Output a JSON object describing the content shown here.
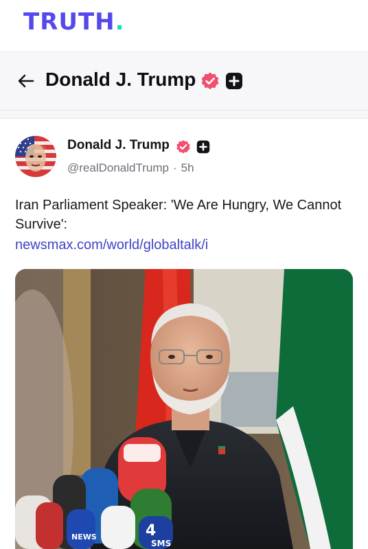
{
  "brand": {
    "logo_text": "TRUTH",
    "logo_dot": ".",
    "primary_color": "#5448ee",
    "dot_color": "#17e0b8"
  },
  "header": {
    "title": "Donald J. Trump",
    "back_icon": "arrow-left-icon",
    "verified_icon": "verified-badge-icon",
    "plus_icon": "truth-plus-icon",
    "verified_color": "#f0506e"
  },
  "post": {
    "author": {
      "name": "Donald J. Trump",
      "handle": "@realDonaldTrump",
      "separator": "·",
      "time": "5h"
    },
    "text": "Iran Parliament Speaker: 'We Are Hungry, We Cannot Survive':",
    "link": "newsmax.com/world/globaltalk/i",
    "link_color": "#3f43c8"
  },
  "media": {
    "microphone_labels": [
      "4",
      "NEWS",
      "SMS"
    ]
  }
}
